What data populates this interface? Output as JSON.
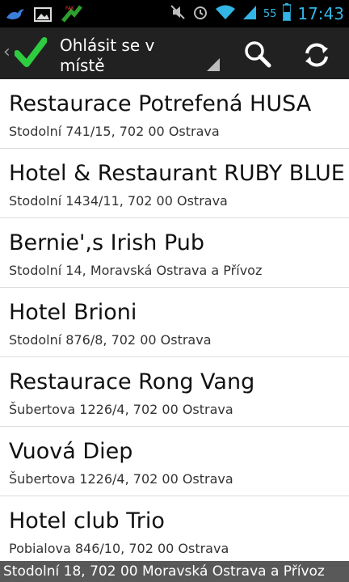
{
  "status_bar": {
    "battery_percent": "55",
    "time": "17:43",
    "icons": [
      "bird-icon",
      "image-icon",
      "fake-location-icon",
      "mute-icon",
      "alarm-icon",
      "wifi-icon",
      "signal-icon",
      "battery-icon"
    ]
  },
  "action_bar": {
    "title": "Ohlásit se v místě",
    "icons": [
      "back-icon",
      "checkmark-icon",
      "spinner-icon",
      "search-icon",
      "refresh-icon"
    ]
  },
  "places": [
    {
      "name": "Restaurace Potrefená HUSA",
      "address": "Stodolní 741/15, 702 00 Ostrava"
    },
    {
      "name": "Hotel & Restaurant RUBY BLUE",
      "address": "Stodolní 1434/11, 702 00 Ostrava"
    },
    {
      "name": "Bernie',s Irish Pub",
      "address": "Stodolní 14, Moravská Ostrava a Přívoz"
    },
    {
      "name": "Hotel Brioni",
      "address": "Stodolní 876/8, 702 00 Ostrava"
    },
    {
      "name": "Restaurace Rong Vang",
      "address": "Šubertova 1226/4, 702 00 Ostrava"
    },
    {
      "name": "Vuová Diep",
      "address": "Šubertova 1226/4, 702 00 Ostrava"
    },
    {
      "name": "Hotel club Trio",
      "address": "Pobialova 846/10, 702 00 Ostrava"
    }
  ],
  "toast": "Stodolní 18, 702 00 Moravská Ostrava a Přívoz",
  "colors": {
    "accent": "#33b5e5",
    "check": "#2ecc40",
    "action_bar": "#212121"
  }
}
